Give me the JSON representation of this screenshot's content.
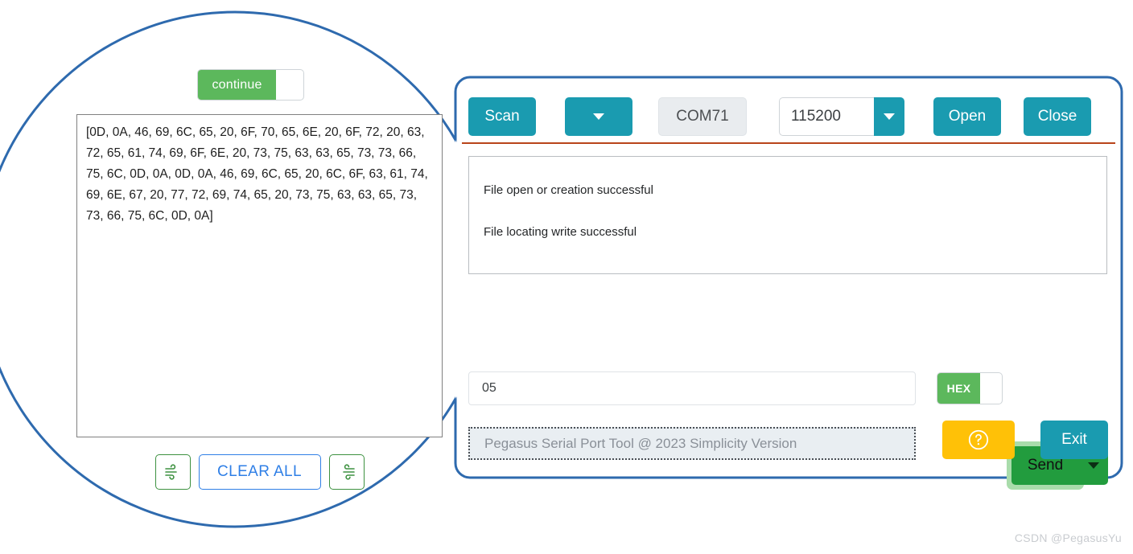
{
  "callout": {
    "outline_color": "#2e6aae"
  },
  "zoom_panel": {
    "continue_toggle": {
      "label": "continue",
      "state": "on",
      "on_color": "#5cb85c"
    },
    "hexdump": {
      "value": "[0D, 0A, 46, 69, 6C, 65, 20, 6F, 70, 65, 6E, 20, 6F, 72, 20, 63, 72, 65, 61, 74, 69, 6F, 6E, 20, 73, 75, 63, 63, 65, 73, 73, 66, 75, 6C, 0D, 0A, 0D, 0A, 46, 69, 6C, 65, 20, 6C, 6F, 63, 61, 74, 69, 6E, 67, 20, 77, 72, 69, 74, 65, 20, 73, 75, 63, 63, 65, 73, 73, 66, 75, 6C, 0D, 0A]"
    },
    "buttons": {
      "clear_receive_icon": "wind-clear-icon",
      "clear_all_label": "CLEAR ALL",
      "clear_send_icon": "wind-clear-icon"
    }
  },
  "app": {
    "toolbar": {
      "scan_label": "Scan",
      "port_dropdown_icon": "chevron-down-icon",
      "port_value": "COM71",
      "baud_value": "115200",
      "baud_dropdown_icon": "chevron-down-icon",
      "open_label": "Open",
      "close_label": "Close",
      "accent_color": "#1a9bb0",
      "divider_color": "#b9441a"
    },
    "log": {
      "lines": [
        "File open or creation successful",
        "File locating write successful"
      ]
    },
    "send_row": {
      "input_value": "05",
      "hex_toggle_label": "HEX",
      "hex_toggle_state": "on",
      "send_label": "Send",
      "send_dropdown_icon": "chevron-down-icon",
      "send_color": "#229c3e"
    },
    "bottom_row": {
      "status_text": "Pegasus Serial Port Tool @ 2023 Simplicity Version",
      "help_icon": "question-circle-icon",
      "help_color": "#ffc107",
      "exit_label": "Exit"
    }
  },
  "watermark": {
    "text": "CSDN @PegasusYu"
  }
}
